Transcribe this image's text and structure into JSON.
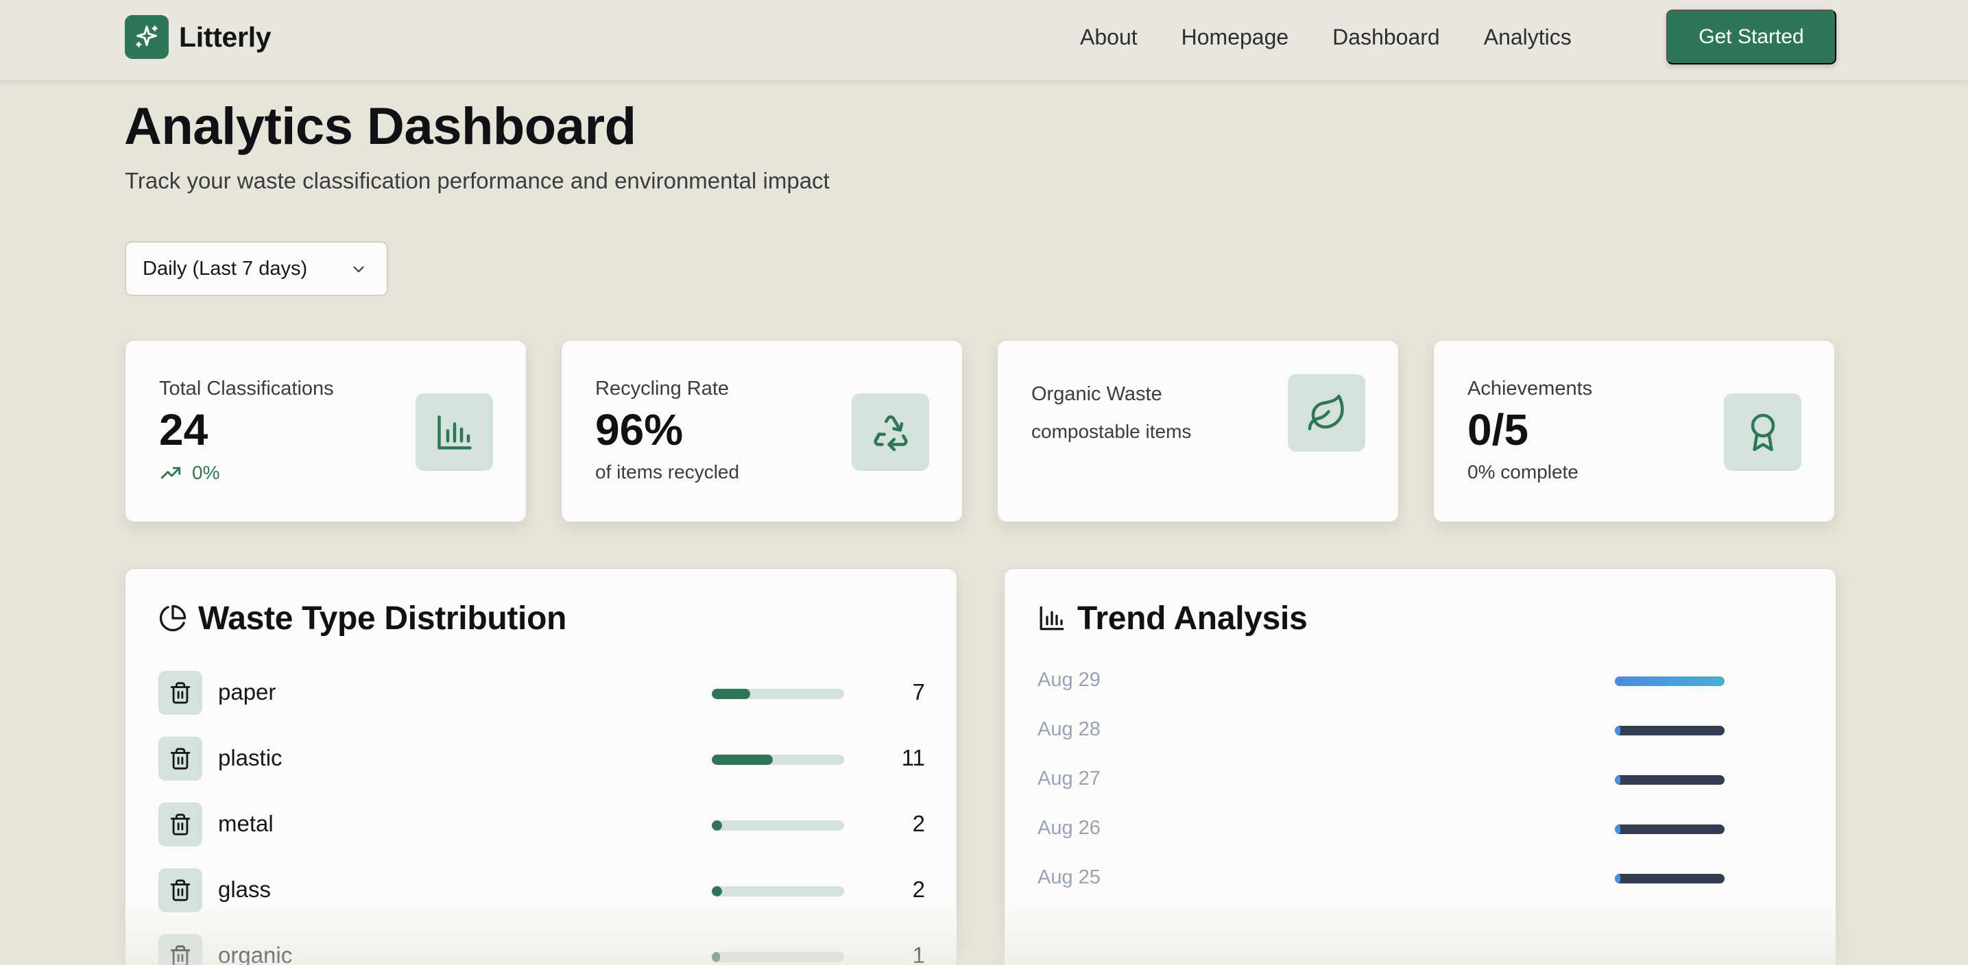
{
  "brand": {
    "name": "Litterly",
    "logo_icon": "sparkle-icon"
  },
  "nav": {
    "links": [
      "About",
      "Homepage",
      "Dashboard",
      "Analytics"
    ],
    "cta_label": "Get Started"
  },
  "header": {
    "title": "Analytics Dashboard",
    "subtitle": "Track your waste classification performance and environmental impact"
  },
  "period_select": {
    "value": "Daily (Last 7 days)"
  },
  "stats": [
    {
      "label": "Total Classifications",
      "value": "24",
      "sub": "0%",
      "icon": "bar-chart-icon",
      "sub_icon": "trending-up-icon"
    },
    {
      "label": "Recycling Rate",
      "value": "96%",
      "sub": "of items recycled",
      "icon": "recycle-icon"
    },
    {
      "label": "Organic Waste",
      "value": "",
      "sub": "compostable items",
      "icon": "leaf-icon"
    },
    {
      "label": "Achievements",
      "value": "0/5",
      "sub": "0% complete",
      "icon": "award-icon"
    }
  ],
  "distribution": {
    "title": "Waste Type Distribution",
    "icon": "pie-chart-icon",
    "items": [
      {
        "name": "paper",
        "count": "7",
        "share": 0.29
      },
      {
        "name": "plastic",
        "count": "11",
        "share": 0.46
      },
      {
        "name": "metal",
        "count": "2",
        "share": 0.08
      },
      {
        "name": "glass",
        "count": "2",
        "share": 0.08
      },
      {
        "name": "organic",
        "count": "1",
        "share": 0.04
      }
    ]
  },
  "trend": {
    "title": "Trend Analysis",
    "icon": "bar-chart-icon",
    "rows": [
      {
        "date": "Aug 29",
        "share": 1.0,
        "active": true
      },
      {
        "date": "Aug 28",
        "share": 0.04,
        "active": false
      },
      {
        "date": "Aug 27",
        "share": 0.04,
        "active": false
      },
      {
        "date": "Aug 26",
        "share": 0.04,
        "active": false
      },
      {
        "date": "Aug 25",
        "share": 0.04,
        "active": false
      }
    ]
  },
  "colors": {
    "accent": "#2f7557",
    "accent_soft": "#d4e2dc",
    "page_bg": "#e7e4da",
    "trend_bar": "#323d52",
    "trend_highlight": "#4a8fd8",
    "trend_date": "#97a3b5"
  }
}
